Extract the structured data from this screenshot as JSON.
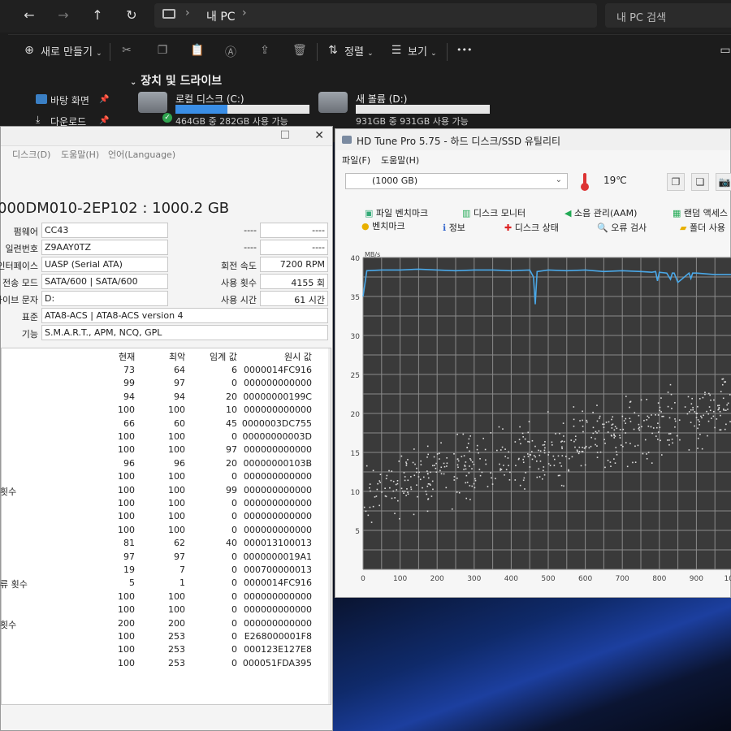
{
  "explorer": {
    "breadcrumb": "내 PC",
    "search_placeholder": "내 PC 검색",
    "toolbar": {
      "new_label": "새로 만들기",
      "sort_label": "정렬",
      "view_label": "보기",
      "more_label": "•••"
    },
    "nav": [
      {
        "label": "바탕 화면"
      },
      {
        "label": "다운로드"
      }
    ],
    "section_header": "장치 및 드라이브",
    "drives": [
      {
        "name": "로컬 디스크 (C:)",
        "info": "464GB 중 282GB 사용 가능",
        "used_fraction": 0.39
      },
      {
        "name": "새 볼륨 (D:)",
        "info": "931GB 중 931GB 사용 가능",
        "used_fraction": 0.0
      }
    ]
  },
  "cdi": {
    "menu": [
      "디스크(D)",
      "도움말(H)",
      "언어(Language)"
    ],
    "close_glyph": "✕",
    "model": "000DM010-2EP102 : 1000.2 GB",
    "left_fields": [
      {
        "label": "펌웨어",
        "value": "CC43"
      },
      {
        "label": "일련번호",
        "value": "Z9AAY0TZ"
      },
      {
        "label": "인터페이스",
        "value": "UASP (Serial ATA)"
      },
      {
        "label": "전송 모드",
        "value": "SATA/600 | SATA/600"
      },
      {
        "label": "드라이브 문자",
        "value": "D:"
      }
    ],
    "right_fields": [
      {
        "label": "----",
        "value": "----"
      },
      {
        "label": "----",
        "value": "----"
      },
      {
        "label": "회전 속도",
        "value": "7200 RPM"
      },
      {
        "label": "사용 횟수",
        "value": "4155 회"
      },
      {
        "label": "사용 시간",
        "value": "61 시간"
      }
    ],
    "standard_label": "표준",
    "standard_value": "ATA8-ACS | ATA8-ACS version 4",
    "features_label": "기능",
    "features_value": "S.M.A.R.T., APM, NCQ, GPL",
    "table_headers": {
      "current": "현재",
      "worst": "최악",
      "threshold": "임계 값",
      "raw": "원시 값"
    },
    "rows": [
      {
        "name": "",
        "current": "73",
        "worst": "64",
        "threshold": "6",
        "raw": "0000014FC916"
      },
      {
        "name": "",
        "current": "99",
        "worst": "97",
        "threshold": "0",
        "raw": "000000000000"
      },
      {
        "name": "",
        "current": "94",
        "worst": "94",
        "threshold": "20",
        "raw": "00000000199C"
      },
      {
        "name": "",
        "current": "100",
        "worst": "100",
        "threshold": "10",
        "raw": "000000000000"
      },
      {
        "name": "",
        "current": "66",
        "worst": "60",
        "threshold": "45",
        "raw": "0000003DC755"
      },
      {
        "name": "",
        "current": "100",
        "worst": "100",
        "threshold": "0",
        "raw": "00000000003D"
      },
      {
        "name": "",
        "current": "100",
        "worst": "100",
        "threshold": "97",
        "raw": "000000000000"
      },
      {
        "name": "",
        "current": "96",
        "worst": "96",
        "threshold": "20",
        "raw": "00000000103B"
      },
      {
        "name": "",
        "current": "100",
        "worst": "100",
        "threshold": "0",
        "raw": "000000000000"
      },
      {
        "name": "횟수",
        "current": "100",
        "worst": "100",
        "threshold": "99",
        "raw": "000000000000"
      },
      {
        "name": "",
        "current": "100",
        "worst": "100",
        "threshold": "0",
        "raw": "000000000000"
      },
      {
        "name": "",
        "current": "100",
        "worst": "100",
        "threshold": "0",
        "raw": "000000000000"
      },
      {
        "name": "",
        "current": "100",
        "worst": "100",
        "threshold": "0",
        "raw": "000000000000"
      },
      {
        "name": "",
        "current": "81",
        "worst": "62",
        "threshold": "40",
        "raw": "000013100013"
      },
      {
        "name": "",
        "current": "97",
        "worst": "97",
        "threshold": "0",
        "raw": "0000000019A1"
      },
      {
        "name": "",
        "current": "19",
        "worst": "7",
        "threshold": "0",
        "raw": "000700000013"
      },
      {
        "name": "류 횟수",
        "current": "5",
        "worst": "1",
        "threshold": "0",
        "raw": "0000014FC916"
      },
      {
        "name": "",
        "current": "100",
        "worst": "100",
        "threshold": "0",
        "raw": "000000000000"
      },
      {
        "name": "",
        "current": "100",
        "worst": "100",
        "threshold": "0",
        "raw": "000000000000"
      },
      {
        "name": "횟수",
        "current": "200",
        "worst": "200",
        "threshold": "0",
        "raw": "000000000000"
      },
      {
        "name": "",
        "current": "100",
        "worst": "253",
        "threshold": "0",
        "raw": "E268000001F8"
      },
      {
        "name": "",
        "current": "100",
        "worst": "253",
        "threshold": "0",
        "raw": "000123E127E8"
      },
      {
        "name": "",
        "current": "100",
        "worst": "253",
        "threshold": "0",
        "raw": "000051FDA395"
      }
    ]
  },
  "hdtune": {
    "title": "HD Tune Pro 5.75 - 하드 디스크/SSD 유틸리티",
    "menu": [
      "파일(F)",
      "도움말(H)"
    ],
    "drive": "(1000 GB)",
    "temperature": "19℃",
    "tabs_row1": [
      "파일 벤치마크",
      "디스크 모니터",
      "소음 관리(AAM)",
      "랜덤 액세스"
    ],
    "tabs_row2": [
      "벤치마크",
      "정보",
      "디스크 상태",
      "오류 검사",
      "폴더 사용"
    ],
    "colors": {
      "plot_bg": "#3a3a3a",
      "grid": "#8a8a8a",
      "line": "#4aa8e8",
      "dots": "#e0e0e0"
    },
    "chart_data": {
      "type": "line",
      "ylabel": "MB/s",
      "ylim": [
        0,
        40
      ],
      "xlim": [
        0,
        1000
      ],
      "y_ticks": [
        "40",
        "35",
        "30",
        "25",
        "20",
        "15",
        "10",
        "5"
      ],
      "x_ticks": [
        "0",
        "100",
        "200",
        "300",
        "400",
        "500",
        "600",
        "700",
        "800",
        "900",
        "1000"
      ],
      "series": [
        {
          "x": [
            0,
            10,
            50,
            100,
            150,
            200,
            250,
            300,
            350,
            400,
            450,
            460,
            465,
            470,
            500,
            550,
            600,
            650,
            700,
            750,
            780,
            790,
            795,
            800,
            820,
            830,
            835,
            840,
            850,
            880,
            885,
            890,
            900,
            950,
            1000
          ],
          "y": [
            35,
            38.3,
            38.4,
            38.4,
            38.5,
            38.4,
            38.3,
            38.4,
            38.4,
            38.3,
            38.4,
            37.5,
            34,
            38.2,
            38.4,
            38.3,
            38.4,
            38.2,
            38.3,
            38.2,
            38.1,
            38.2,
            37,
            38.1,
            38.0,
            37.2,
            38.0,
            38.0,
            36.8,
            38.0,
            37.3,
            38.0,
            38.0,
            37.8,
            37.8
          ]
        }
      ],
      "access_time_scatter": {
        "x_range": [
          0,
          1000
        ],
        "y_center_start": 10,
        "y_center_end": 21,
        "spread": 4
      }
    }
  }
}
